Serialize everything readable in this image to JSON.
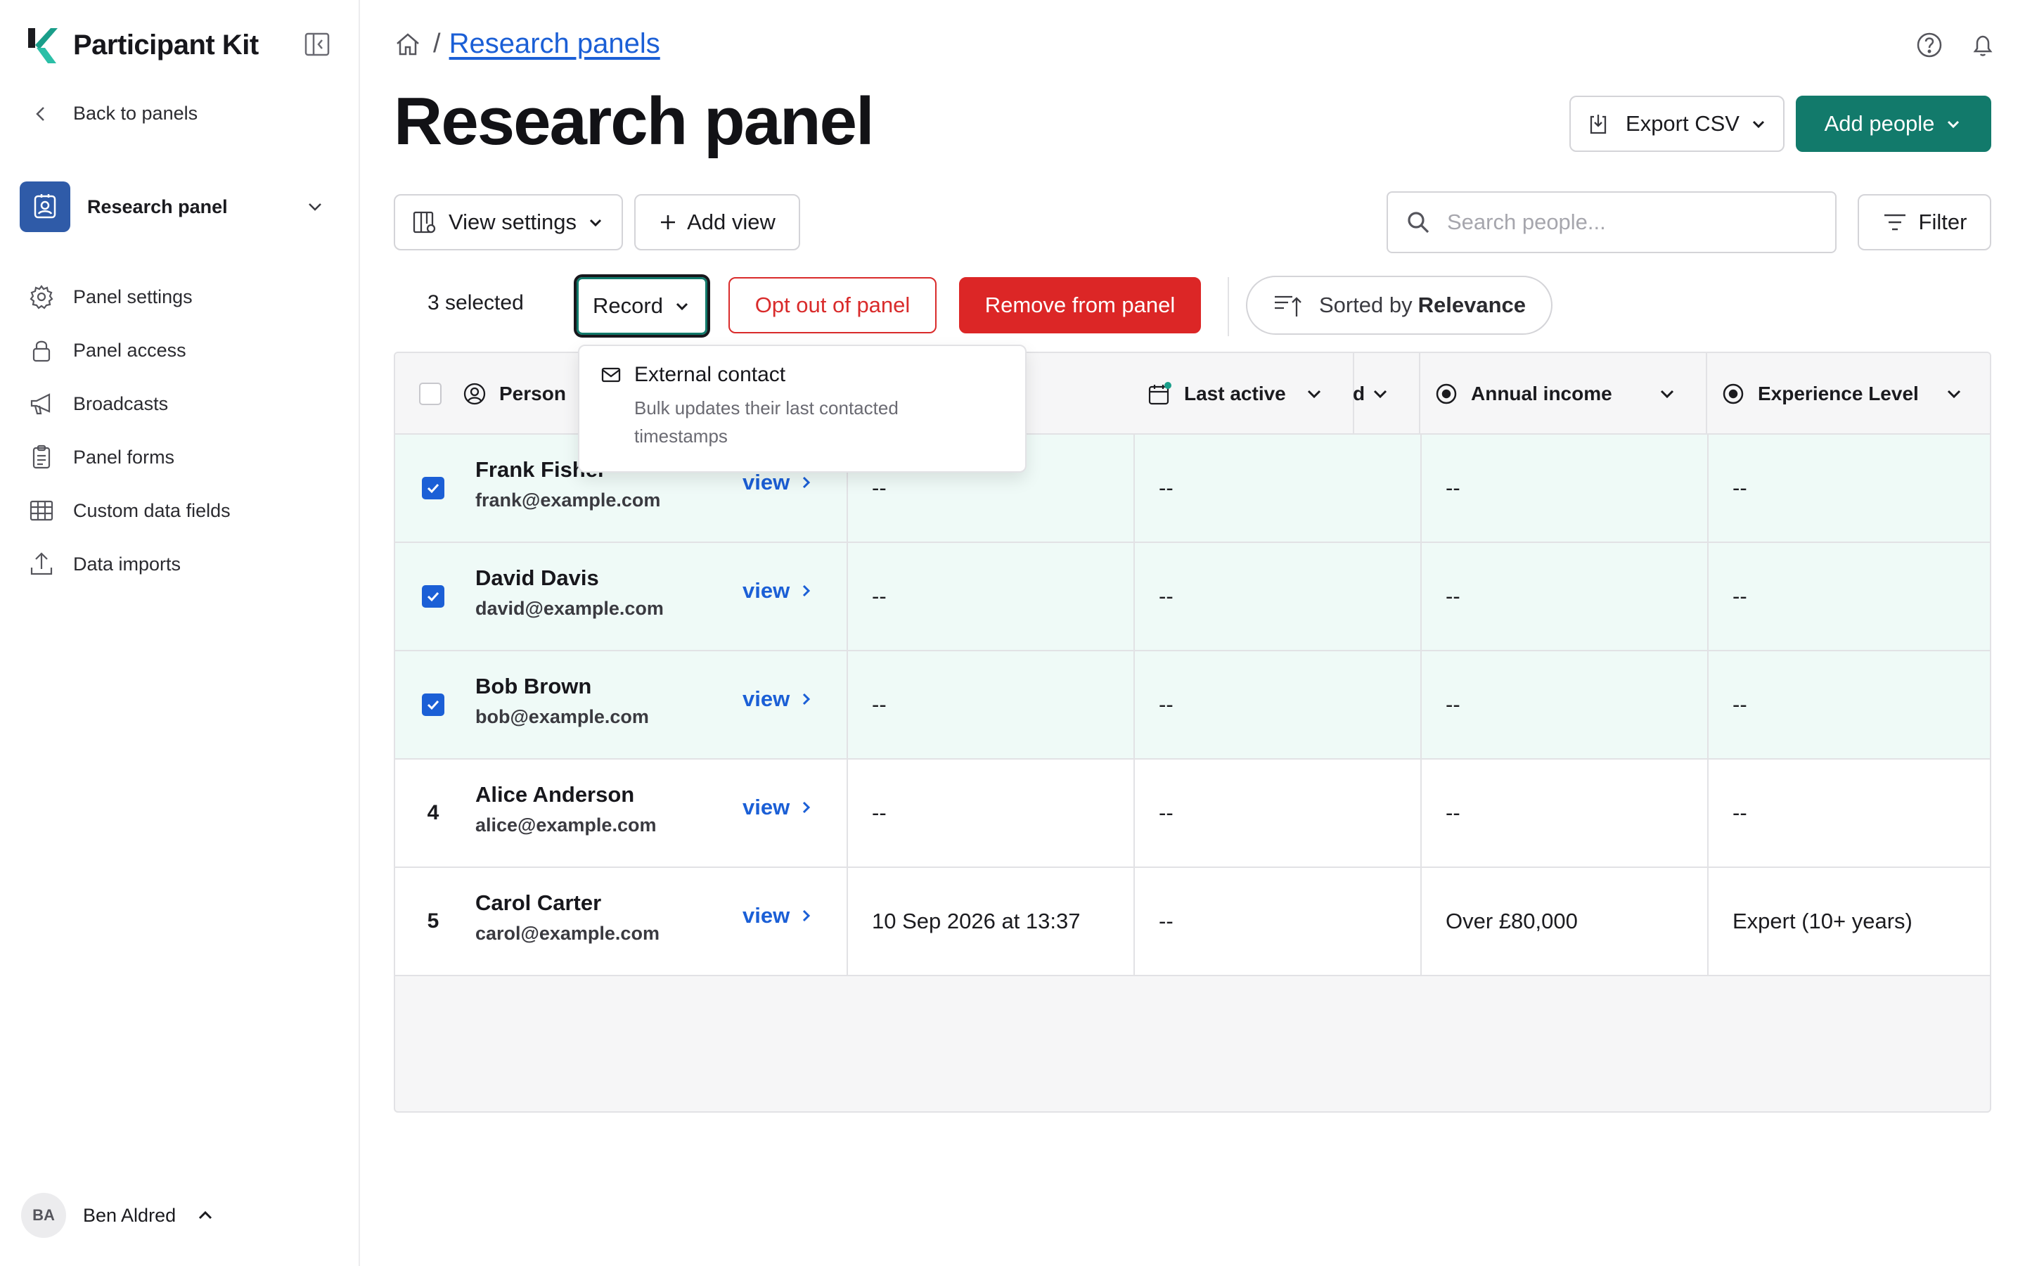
{
  "sidebar": {
    "app_title": "Participant Kit",
    "back_label": "Back to panels",
    "panel_name": "Research panel",
    "items": [
      {
        "label": "Panel settings",
        "icon": "gear-icon"
      },
      {
        "label": "Panel access",
        "icon": "lock-icon"
      },
      {
        "label": "Broadcasts",
        "icon": "megaphone-icon"
      },
      {
        "label": "Panel forms",
        "icon": "clipboard-icon"
      },
      {
        "label": "Custom data fields",
        "icon": "table-icon"
      },
      {
        "label": "Data imports",
        "icon": "upload-icon"
      }
    ],
    "user": {
      "initials": "BA",
      "name": "Ben Aldred"
    }
  },
  "breadcrumb": {
    "separator": "/",
    "current": "Research panels"
  },
  "page_title": "Research panel",
  "actions": {
    "export_label": "Export CSV",
    "add_people_label": "Add people"
  },
  "toolbar": {
    "view_settings_label": "View settings",
    "add_view_label": "Add view",
    "search_placeholder": "Search people...",
    "filter_label": "Filter"
  },
  "bulk": {
    "selected_text": "3 selected",
    "record_label": "Record",
    "optout_label": "Opt out of panel",
    "remove_label": "Remove from panel",
    "sort_prefix": "Sorted by",
    "sort_value": "Relevance"
  },
  "dropdown": {
    "title": "External contact",
    "description": "Bulk updates their last contacted timestamps"
  },
  "table": {
    "columns": [
      "Person",
      "d",
      "Last active",
      "Annual income",
      "Experience Level"
    ],
    "view_label": "view",
    "rows": [
      {
        "selected": true,
        "num": "",
        "name": "Frank Fisher",
        "email": "frank@example.com",
        "c1": "--",
        "c2": "--",
        "c3": "--",
        "c4": "--"
      },
      {
        "selected": true,
        "num": "",
        "name": "David Davis",
        "email": "david@example.com",
        "c1": "--",
        "c2": "--",
        "c3": "--",
        "c4": "--"
      },
      {
        "selected": true,
        "num": "",
        "name": "Bob Brown",
        "email": "bob@example.com",
        "c1": "--",
        "c2": "--",
        "c3": "--",
        "c4": "--"
      },
      {
        "selected": false,
        "num": "4",
        "name": "Alice Anderson",
        "email": "alice@example.com",
        "c1": "--",
        "c2": "--",
        "c3": "--",
        "c4": "--"
      },
      {
        "selected": false,
        "num": "5",
        "name": "Carol Carter",
        "email": "carol@example.com",
        "c1": "10 Sep 2026 at 13:37",
        "c2": "--",
        "c3": "Over £80,000",
        "c4": "Expert (10+ years)"
      }
    ]
  },
  "colors": {
    "brand_teal": "#127a6b",
    "link_blue": "#1b5fd6",
    "danger_red": "#dc2626",
    "panel_badge": "#2f5ba8"
  }
}
